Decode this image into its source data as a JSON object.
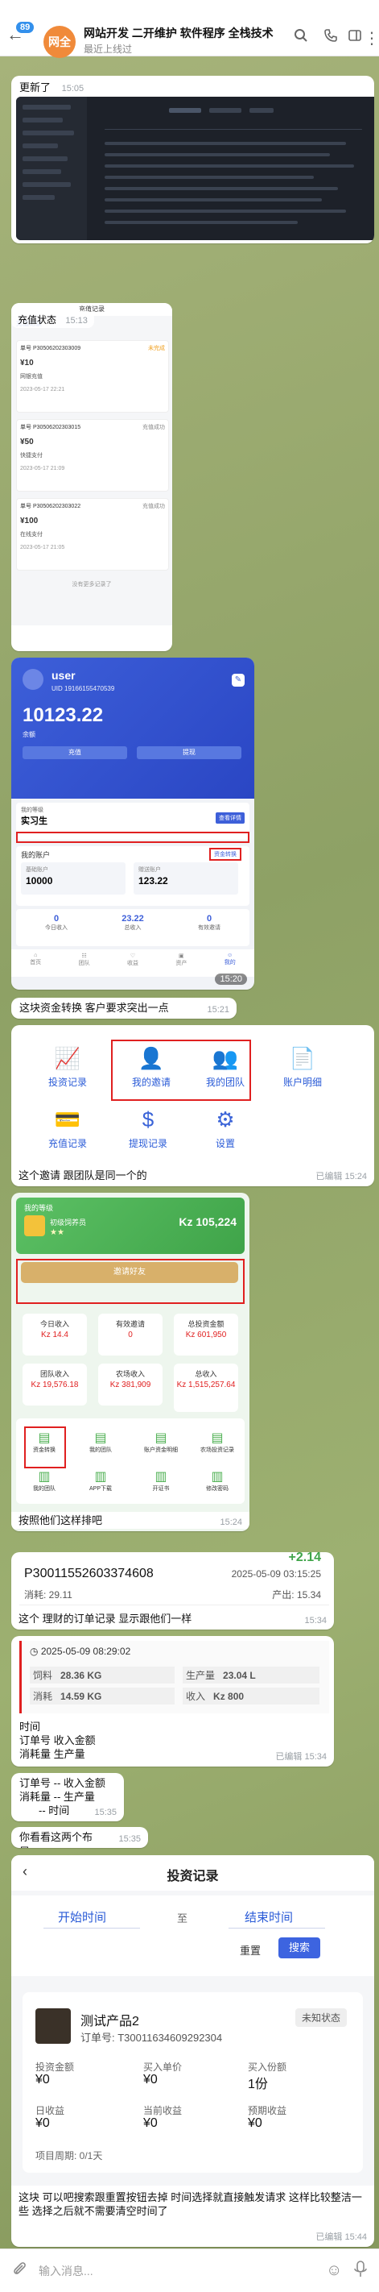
{
  "header": {
    "back_label": "←",
    "unread_count": "89",
    "avatar_text": "网全",
    "avatar_color": "#f08a3a",
    "title": "网站开发 二开维护 软件程序 全栈技术",
    "status": "最近上线过",
    "icons": [
      "search-icon",
      "phone-icon",
      "sidebar-icon",
      "more-icon"
    ]
  },
  "messages": {
    "m1": {
      "caption": "更新了",
      "time": "15:05"
    },
    "m2": {
      "caption": "充值状态",
      "time": "15:13",
      "screen_title": "充值记录",
      "screen_header": "充值记录",
      "records": [
        {
          "order": "单号 P30506202303009",
          "badge": "未完成",
          "amount": "¥10",
          "method": "网银充值",
          "date": "2023-05-17 22:21"
        },
        {
          "order": "单号 P30506202303015",
          "badge": "充值成功",
          "amount": "¥50",
          "method": "快捷支付",
          "date": "2023-05-17 21:09"
        },
        {
          "order": "单号 P30506202303022",
          "badge": "充值成功",
          "amount": "¥100",
          "method": "在线支付",
          "date": "2023-05-17 21:05"
        }
      ],
      "footer": "没有更多记录了"
    },
    "m3": {
      "time": "15:20",
      "user_name": "user",
      "user_id": "UID 19166155470539",
      "balance": "10123.22",
      "balance_label": "余额",
      "btn_recharge": "充值",
      "btn_withdraw": "提现",
      "level_label": "我的等级",
      "level_name": "实习生",
      "level_btn": "查看详情",
      "account_label": "我的账户",
      "account_btn": "资金转换",
      "base_label": "基础账户",
      "base_value": "10000",
      "reward_label": "赠送账户",
      "reward_value": "123.22",
      "today_label": "今日收入",
      "today_value": "0",
      "total_label": "总收入",
      "total_value": "23.22",
      "valid_label": "有效邀请",
      "valid_value": "0",
      "nav": [
        "首页",
        "团队",
        "收益",
        "资产",
        "我的"
      ]
    },
    "m4": {
      "text": "这块资金转换 客户要求突出一点",
      "time": "15:21"
    },
    "m5": {
      "caption": "这个邀请 跟团队是同一个的",
      "time": "已编辑 15:24",
      "icons": [
        {
          "label": "投资记录",
          "icon": "chart-icon"
        },
        {
          "label": "我的邀请",
          "icon": "add-user-icon"
        },
        {
          "label": "我的团队",
          "icon": "team-icon"
        },
        {
          "label": "账户明细",
          "icon": "document-icon"
        },
        {
          "label": "充值记录",
          "icon": "recharge-icon"
        },
        {
          "label": "提现记录",
          "icon": "dollar-icon"
        },
        {
          "label": "设置",
          "icon": "gear-icon"
        }
      ]
    },
    "m6": {
      "caption": "按照他们这样排吧",
      "time": "15:24",
      "level_title": "我的等级",
      "level_name": "初级饲养员",
      "stars": "★★",
      "amount": "Kz 105,224",
      "invite_btn": "邀请好友",
      "stats": [
        {
          "label": "今日收入",
          "value": "Kz 14.4"
        },
        {
          "label": "有效邀请",
          "value": "0"
        },
        {
          "label": "总投资金额",
          "value": "Kz 601,950"
        },
        {
          "label": "团队收入",
          "value": "Kz 19,576.18"
        },
        {
          "label": "农场收入",
          "value": "Kz 381,909"
        },
        {
          "label": "总收入",
          "value": "Kz 1,515,257.64"
        }
      ],
      "menu1": [
        "资金转换",
        "我的团队",
        "账户资金明细",
        "农场投资记录"
      ],
      "menu2": [
        "我的团队",
        "APP下载",
        "开证书",
        "修改密码"
      ]
    },
    "m7": {
      "order_no": "P30011552603374608",
      "amount_top": "+2.14",
      "datetime": "2025-05-09 03:15:25",
      "consumed": "消耗: 29.11",
      "output": "产出: 15.34",
      "caption": "这个 理财的订单记录 显示跟他们一样",
      "time": "15:34"
    },
    "m8": {
      "date": "2025-05-09 08:29:02",
      "r1_l": "饲料",
      "r1_v": "28.36 KG",
      "r1_l2": "生产量",
      "r1_v2": "23.04 L",
      "r2_l": "消耗",
      "r2_v": "14.59 KG",
      "r2_l2": "收入",
      "r2_v2": "Kz 800",
      "lines": [
        "时间",
        "订单号 收入金额",
        "消耗量 生产量"
      ],
      "time": "已编辑 15:34"
    },
    "m9": {
      "lines": [
        "订单号 -- 收入金额",
        "消耗量 -- 生产量",
        "-- 时间"
      ],
      "time": "15:35"
    },
    "m10": {
      "text": "你看看这两个布局",
      "time": "15:35"
    },
    "m11": {
      "title": "投资记录",
      "start": "开始时间",
      "to": "至",
      "end": "结束时间",
      "reset": "重置",
      "search": "搜索",
      "product": "测试产品2",
      "status": "未知状态",
      "order": "订单号: T30011634609292304",
      "f1_l": "投资金额",
      "f1_v": "¥0",
      "f2_l": "买入单价",
      "f2_v": "¥0",
      "f3_l": "买入份额",
      "f3_v": "1份",
      "f4_l": "日收益",
      "f4_v": "¥0",
      "f5_l": "当前收益",
      "f5_v": "¥0",
      "f6_l": "预期收益",
      "f6_v": "¥0",
      "period": "项目周期: 0/1天",
      "caption": "这块 可以吧搜索跟重置按钮去掉 时间选择就直接触发请求 这样比较整洁一些 选择之后就不需要清空时间了",
      "time": "已编辑 15:44"
    }
  },
  "composer": {
    "placeholder": "输入消息...",
    "icons": [
      "attach-icon",
      "emoji-icon",
      "mic-icon"
    ]
  }
}
